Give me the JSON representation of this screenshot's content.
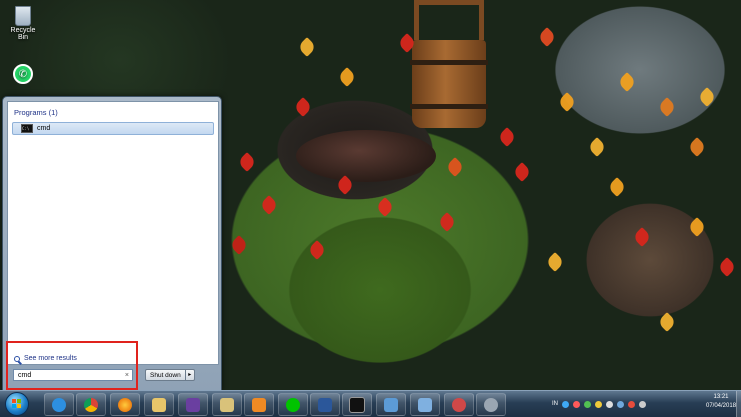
{
  "desktop": {
    "icons": [
      {
        "label": "Recycle Bin",
        "icon": "recycle-bin-icon"
      },
      {
        "label": "",
        "icon": "whatsapp-icon"
      }
    ]
  },
  "start_menu": {
    "section_title": "Programs (1)",
    "results": [
      {
        "label": "cmd",
        "icon": "command-prompt-icon"
      }
    ],
    "see_more_label": "See more results",
    "search": {
      "value": "cmd",
      "clear_icon": "×"
    },
    "shutdown_label": "Shut down",
    "shutdown_arrow": "▸"
  },
  "taskbar": {
    "pinned": [
      "internet-explorer-icon",
      "chrome-icon",
      "firefox-icon",
      "file-explorer-icon",
      "visual-studio-icon",
      "folder-icon",
      "media-player-icon",
      "line-icon",
      "word-icon",
      "command-prompt-icon",
      "network-icon",
      "window-icon",
      "paint-icon",
      "settings-icon"
    ],
    "tray": {
      "language": "IN"
    },
    "clock": {
      "time": "13:21",
      "date": "07/04/2018"
    }
  },
  "colors": {
    "highlight_border": "#e0231d",
    "start_accent": "#1e3287"
  }
}
